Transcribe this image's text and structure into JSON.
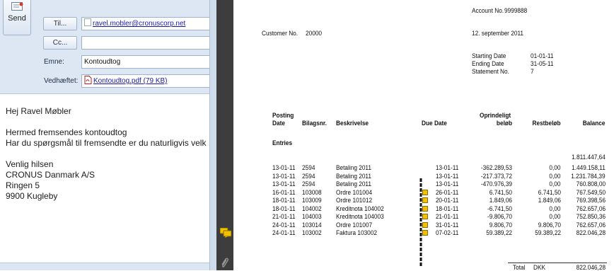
{
  "email": {
    "send_label": "Send",
    "to_button": "Til...",
    "cc_button": "Cc...",
    "to_value": "ravel.mobler@cronuscorp.net",
    "cc_value": "",
    "subject_label": "Emne:",
    "subject_value": "Kontoudtog",
    "attached_label": "Vedhæftet:",
    "attachment_name": "Kontoudtog.pdf (79 KB)",
    "body_lines": [
      "Hej Ravel Møbler",
      "",
      "Hermed fremsendes kontoudtog",
      "Har du spørgsmål til fremsendte  er du naturligvis velk",
      "",
      "Venlig hilsen",
      "CRONUS Danmark A/S",
      "Ringen 5",
      "9900 Kugleby"
    ]
  },
  "statement": {
    "account_label": "Account No.",
    "account_value": "9999888",
    "customer_label": "Customer No.",
    "customer_value": "20000",
    "date": "12. september 2011",
    "starting_label": "Starting Date",
    "starting_value": "01-01-11",
    "ending_label": "Ending Date",
    "ending_value": "31-05-11",
    "statement_label": "Statement No.",
    "statement_value": "7",
    "headers": {
      "posting": "Posting",
      "date": "Date",
      "bilag": "Bilagsnr.",
      "beskrivelse": "Beskrivelse",
      "due": "Due Date",
      "oprindeligt": "Oprindeligt",
      "belob": "beløb",
      "restbelob": "Restbeløb",
      "balance": "Balance"
    },
    "entries_label": "Entries",
    "opening_balance": "1.811.447,64",
    "rows": [
      {
        "date": "13-01-11",
        "doc": "2594",
        "desc": "Betaling 2011",
        "due": "13-01-11",
        "amount": "-362.289,53",
        "rest": "0,00",
        "balance": "1.449.158,11"
      },
      {
        "date": "13-01-11",
        "doc": "2594",
        "desc": "Betaling 2011",
        "due": "13-01-11",
        "amount": "-217.373,72",
        "rest": "0,00",
        "balance": "1.231.784,39"
      },
      {
        "date": "13-01-11",
        "doc": "2594",
        "desc": "Betaling 2011",
        "due": "13-01-11",
        "amount": "-470.976,39",
        "rest": "0,00",
        "balance": "760.808,00"
      },
      {
        "date": "16-01-11",
        "doc": "103008",
        "desc": "Ordre 101004",
        "due": "26-01-11",
        "amount": "6.741,50",
        "rest": "6.741,50",
        "balance": "767.549,50"
      },
      {
        "date": "18-01-11",
        "doc": "103009",
        "desc": "Ordre 101012",
        "due": "20-01-11",
        "amount": "1.849,06",
        "rest": "1.849,06",
        "balance": "769.398,56"
      },
      {
        "date": "18-01-11",
        "doc": "104002",
        "desc": "Kreditnota 104002",
        "due": "18-01-11",
        "amount": "-6.741,50",
        "rest": "0,00",
        "balance": "762.657,06"
      },
      {
        "date": "21-01-11",
        "doc": "104003",
        "desc": "Kreditnota 104003",
        "due": "21-01-11",
        "amount": "-9.806,70",
        "rest": "0,00",
        "balance": "752.850,36"
      },
      {
        "date": "24-01-11",
        "doc": "103014",
        "desc": "Ordre 101007",
        "due": "31-01-11",
        "amount": "9.806,70",
        "rest": "9.806,70",
        "balance": "762.657,06"
      },
      {
        "date": "24-01-11",
        "doc": "103002",
        "desc": "Faktura 103002",
        "due": "07-02-11",
        "amount": "59.389,22",
        "rest": "59.389,22",
        "balance": "822.046,28"
      }
    ],
    "total_label": "Total",
    "total_currency": "DKK",
    "total_balance": "822.046,28"
  },
  "colors": {
    "header_bg": "#dde7f4",
    "link": "#1a1aa6",
    "dark_bar": "#3d3d3d",
    "note_yellow": "#f2c200"
  }
}
